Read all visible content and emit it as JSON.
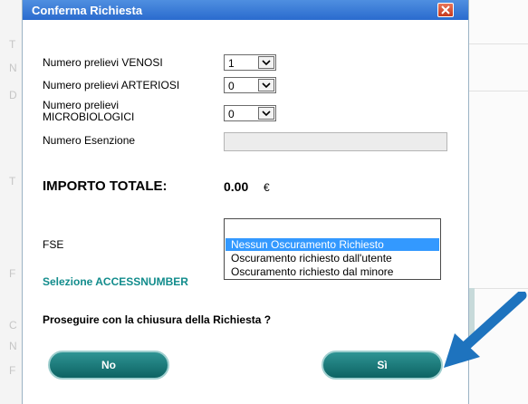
{
  "background": {
    "left_letters": [
      "T",
      "N",
      "D",
      "T",
      "F",
      "C",
      "N",
      "F"
    ]
  },
  "dialog": {
    "title": "Conferma Richiesta",
    "fields": {
      "venosi_label": "Numero prelievi VENOSI",
      "venosi_value": "1",
      "arteriosi_label": "Numero prelievi ARTERIOSI",
      "arteriosi_value": "0",
      "micro_label_line1": "Numero prelievi",
      "micro_label_line2": "MICROBIOLOGICI",
      "micro_value": "0",
      "esenzione_label": "Numero Esenzione",
      "esenzione_value": ""
    },
    "importo": {
      "label": "IMPORTO TOTALE:",
      "value": "0.00",
      "currency": "€"
    },
    "fse": {
      "label": "FSE",
      "options": [
        "",
        "Nessun Oscuramento Richiesto",
        "Oscuramento richiesto dall'utente",
        "Oscuramento richiesto dal minore"
      ],
      "selected_index": 1
    },
    "accessnumber_label": "Selezione ACCESSNUMBER",
    "question": "Proseguire con la chiusura della Richiesta ?",
    "buttons": {
      "no": "No",
      "si": "Sì"
    }
  },
  "colors": {
    "titlebar": "#2a6bce",
    "button": "#0d6363",
    "accent_text": "#128c8c",
    "selection": "#3399ff",
    "arrow": "#1e73be"
  },
  "icons": {
    "close": "close-icon",
    "dropdown": "chevron-down-icon",
    "pointer": "arrow-icon"
  }
}
